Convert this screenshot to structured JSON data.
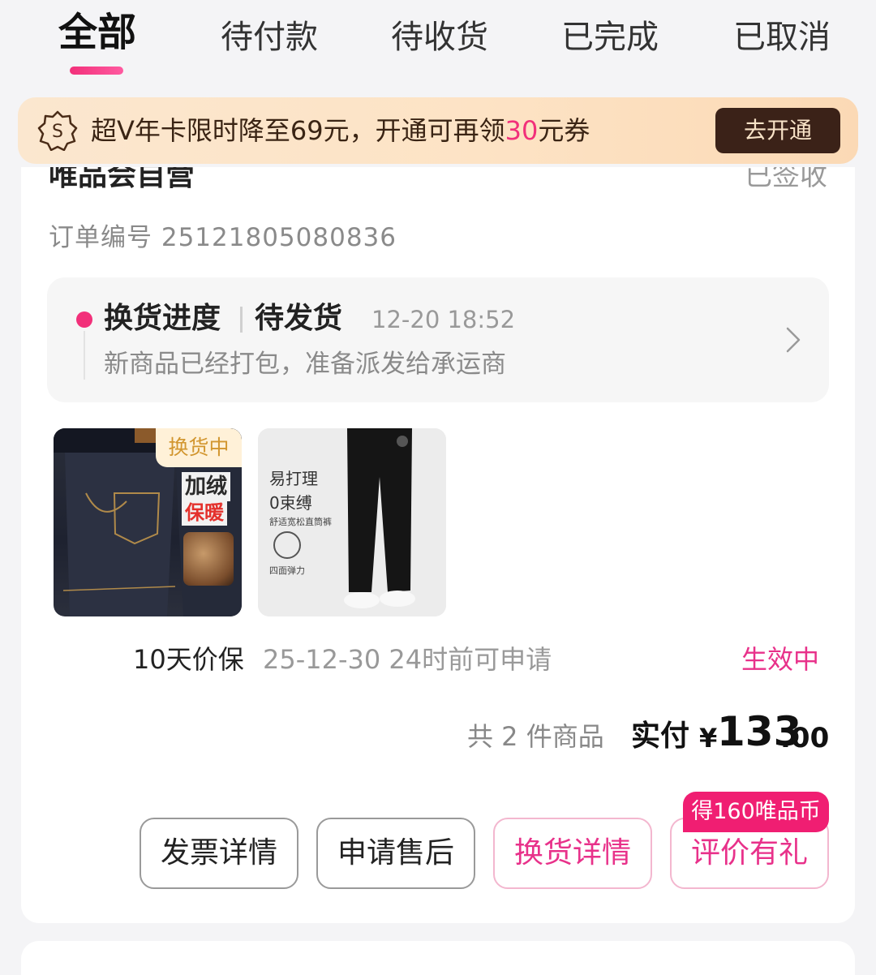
{
  "tabs": [
    {
      "label": "全部",
      "active": true
    },
    {
      "label": "待付款",
      "active": false
    },
    {
      "label": "待收货",
      "active": false
    },
    {
      "label": "已完成",
      "active": false
    },
    {
      "label": "已取消",
      "active": false
    }
  ],
  "promo": {
    "text_before": "超V年卡限时降至69元，开通可再领",
    "highlight": "30",
    "text_after": "元券",
    "button": "去开通",
    "icon": "svip-coin-icon"
  },
  "order": {
    "store_name": "唯品会自营",
    "status": "已签收",
    "order_number_label": "订单编号",
    "order_number": "25121805080836",
    "progress": {
      "title": "换货进度",
      "state": "待发货",
      "time": "12-20 18:52",
      "description": "新商品已经打包，准备派发给承运商"
    },
    "products": [
      {
        "badge": "换货中",
        "tag1": "加绒",
        "tag2": "保暖"
      },
      {
        "text1": "易打理",
        "text2": "0束缚",
        "text3": "舒适宽松直筒裤",
        "text4": "四面弹力"
      }
    ],
    "price_protection": {
      "label": "10天价保",
      "date": "25-12-30 24时前可申请",
      "status": "生效中"
    },
    "totals": {
      "count": "共 2 件商品",
      "paid_label": "实付",
      "currency": "¥",
      "amount_int": "133",
      "amount_dec": ".00"
    },
    "actions": {
      "invoice": "发票详情",
      "after_sale": "申请售后",
      "exchange_detail": "换货详情",
      "review": "评价有礼",
      "coin_tag": "得160唯品币"
    }
  },
  "colors": {
    "accent": "#f2307a",
    "promo_bg": "#fbe7cf",
    "promo_button": "#3b2218",
    "status_active": "#e8318a"
  }
}
